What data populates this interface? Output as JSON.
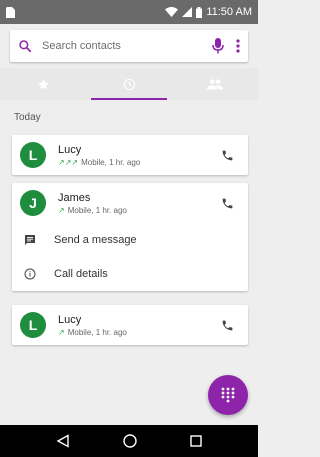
{
  "status_bar": {
    "time": "11:50 AM",
    "icons": [
      "sim-card-icon",
      "wifi-icon",
      "signal-icon",
      "battery-icon"
    ]
  },
  "search": {
    "placeholder": "Search contacts",
    "icons": [
      "search-icon",
      "mic-icon",
      "more-vert-icon"
    ]
  },
  "tabs": [
    {
      "icon": "star-icon",
      "name": "favorites",
      "active": false
    },
    {
      "icon": "clock-icon",
      "name": "recents",
      "active": true
    },
    {
      "icon": "people-icon",
      "name": "contacts",
      "active": false
    }
  ],
  "section_label": "Today",
  "calls": [
    {
      "initial": "L",
      "name": "Lucy",
      "detail": "Mobile, 1 hr. ago",
      "arrows": "↗↗↗"
    },
    {
      "initial": "J",
      "name": "James",
      "detail": "Mobile, 1 hr. ago",
      "arrows": "↗"
    },
    {
      "initial": "L",
      "name": "Lucy",
      "detail": "Mobile, 1 hr. ago",
      "arrows": "↗"
    }
  ],
  "expanded_actions": {
    "send_message": "Send a message",
    "call_details": "Call details"
  },
  "colors": {
    "accent": "#8e24aa",
    "avatar": "#1e8e3e",
    "outgoing_arrow": "#34a853"
  }
}
